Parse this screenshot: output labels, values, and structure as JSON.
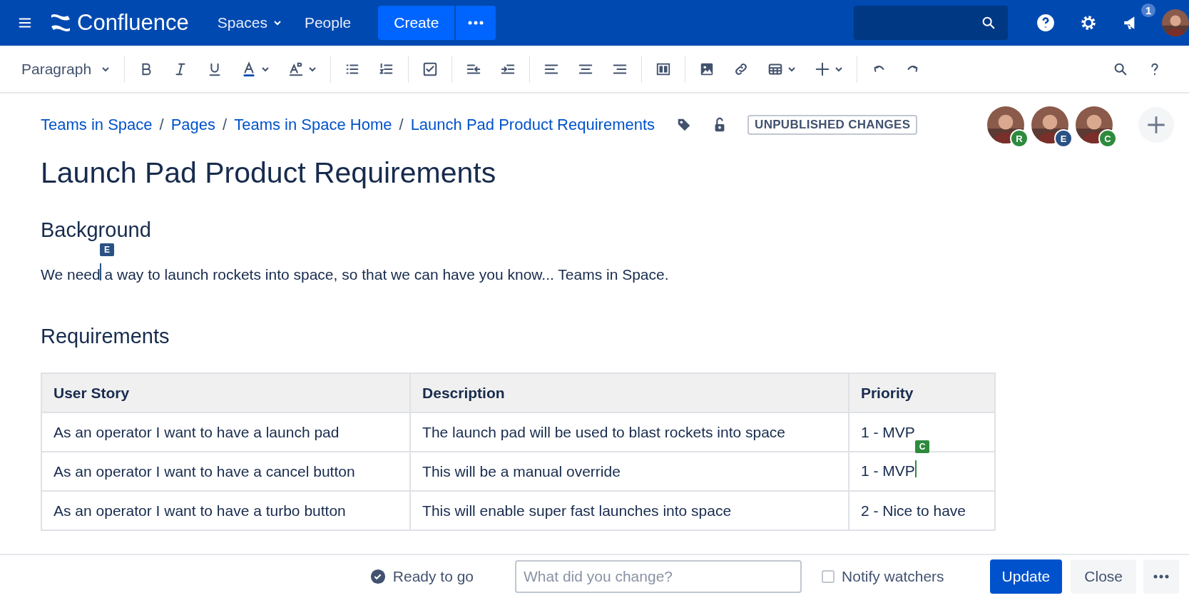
{
  "nav": {
    "logo": "Confluence",
    "items": [
      {
        "label": "Spaces",
        "dropdown": true
      },
      {
        "label": "People",
        "dropdown": false
      }
    ],
    "create": "Create",
    "notifications": "1"
  },
  "toolbar": {
    "style": "Paragraph"
  },
  "breadcrumbs": {
    "separator": "/",
    "items": [
      "Teams in Space",
      "Pages",
      "Teams in Space Home",
      "Launch Pad Product Requirements"
    ]
  },
  "status_label": "UNPUBLISHED CHANGES",
  "collaborators": [
    {
      "initial": "R",
      "color": "#2e8b3e"
    },
    {
      "initial": "E",
      "color": "#2a5184"
    },
    {
      "initial": "C",
      "color": "#2e8b3e"
    }
  ],
  "title": "Launch Pad Product Requirements",
  "background": {
    "heading": "Background",
    "text": "We need a way to launch rockets into space, so that we can have you know... Teams in Space.",
    "cursor": {
      "label": "E",
      "color": "#2a5184"
    }
  },
  "requirements": {
    "heading": "Requirements",
    "columns": [
      "User Story",
      "Description",
      "Priority"
    ],
    "rows": [
      {
        "cells": [
          {
            "text": "As an operator I want to have a launch pad"
          },
          {
            "text": "The launch pad will be used to blast rockets into space"
          },
          {
            "text": "1 - MVP"
          }
        ]
      },
      {
        "cells": [
          {
            "text": "As an operator I want to have a cancel button"
          },
          {
            "text": "This will be a manual override"
          },
          {
            "text": "1 - MVP",
            "cursor": {
              "label": "C",
              "color": "#2e8b3e"
            }
          }
        ]
      },
      {
        "cells": [
          {
            "text": "As an operator I want to have a turbo button"
          },
          {
            "text": "This will enable super fast launches into space"
          },
          {
            "text": "2 - Nice to have"
          }
        ]
      }
    ]
  },
  "footer": {
    "status": "Ready to go",
    "comment_placeholder": "What did you change?",
    "notify": {
      "label": "Notify watchers",
      "checked": false
    },
    "update": "Update",
    "close": "Close"
  }
}
